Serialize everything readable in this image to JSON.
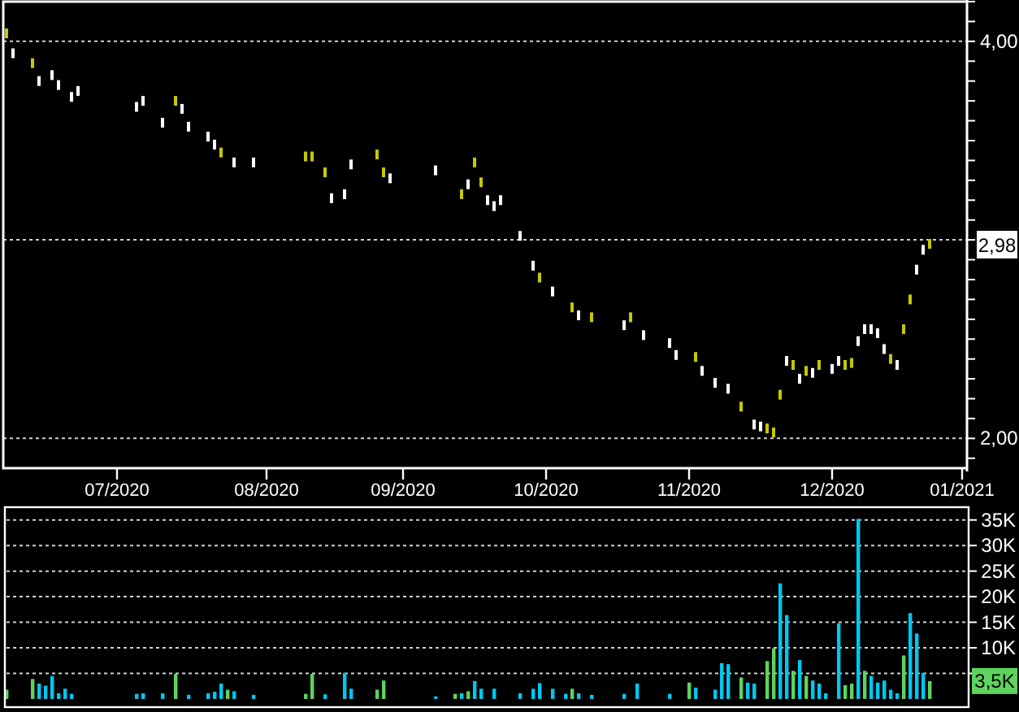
{
  "price_chart": {
    "current_price": "2,98",
    "chart_data": {
      "type": "scatter",
      "grid": true,
      "ylim": [
        1.85,
        4.2
      ],
      "categories": [
        null,
        null,
        null,
        null,
        null,
        null,
        null,
        null,
        null,
        null,
        null,
        null,
        null,
        null,
        null,
        null,
        null,
        "07/2020",
        null,
        null,
        null,
        null,
        null,
        null,
        null,
        null,
        null,
        null,
        null,
        null,
        null,
        null,
        null,
        null,
        null,
        null,
        null,
        null,
        null,
        null,
        "08/2020",
        null,
        null,
        null,
        null,
        null,
        null,
        null,
        null,
        null,
        null,
        null,
        null,
        null,
        null,
        null,
        null,
        null,
        null,
        null,
        null,
        "09/2020",
        null,
        null,
        null,
        null,
        null,
        null,
        null,
        null,
        null,
        null,
        null,
        null,
        null,
        null,
        null,
        null,
        null,
        null,
        null,
        null,
        null,
        "10/2020",
        null,
        null,
        null,
        null,
        null,
        null,
        null,
        null,
        null,
        null,
        null,
        null,
        null,
        null,
        null,
        null,
        null,
        null,
        null,
        null,
        null,
        "11/2020",
        null,
        null,
        null,
        null,
        null,
        null,
        null,
        null,
        null,
        null,
        null,
        null,
        null,
        null,
        null,
        null,
        null,
        null,
        null,
        null,
        null,
        "12/2020",
        null,
        null,
        null,
        null,
        null,
        null,
        null,
        null,
        null,
        null,
        null,
        null,
        null,
        null,
        null,
        null,
        null,
        null,
        null,
        "01/2021"
      ],
      "yticks": [
        {
          "value": 4,
          "label": "4,00"
        },
        {
          "value": 2,
          "label": "2,00"
        }
      ],
      "series": [
        {
          "color": "#c8c800",
          "values": [
            4.04,
            null,
            null,
            null,
            3.89,
            null,
            null,
            null,
            null,
            null,
            null,
            null,
            null,
            null,
            null,
            null,
            null,
            null,
            null,
            null,
            null,
            null,
            null,
            null,
            null,
            null,
            3.7,
            null,
            null,
            null,
            null,
            null,
            null,
            3.44,
            null,
            null,
            null,
            null,
            null,
            null,
            null,
            null,
            null,
            null,
            null,
            null,
            3.42,
            3.42,
            null,
            3.34,
            null,
            null,
            null,
            null,
            null,
            null,
            null,
            3.43,
            3.34,
            null,
            null,
            null,
            null,
            null,
            null,
            null,
            null,
            null,
            null,
            null,
            3.23,
            null,
            3.39,
            3.29,
            null,
            null,
            null,
            null,
            null,
            null,
            null,
            null,
            2.81,
            null,
            null,
            null,
            null,
            2.66,
            null,
            null,
            2.61,
            null,
            null,
            null,
            null,
            null,
            2.61,
            null,
            null,
            null,
            null,
            null,
            null,
            null,
            null,
            null,
            2.41,
            null,
            null,
            null,
            null,
            null,
            null,
            2.16,
            null,
            null,
            null,
            2.05,
            2.03,
            2.22,
            null,
            2.37,
            null,
            2.34,
            null,
            2.37,
            null,
            null,
            null,
            2.37,
            2.38,
            null,
            null,
            null,
            null,
            null,
            2.4,
            null,
            2.55,
            2.7,
            null,
            null,
            2.98,
            null,
            null,
            null,
            null,
            null
          ]
        },
        {
          "color": "#ffffff",
          "values": [
            null,
            3.94,
            null,
            null,
            null,
            3.8,
            null,
            3.83,
            3.78,
            null,
            3.72,
            3.75,
            null,
            null,
            null,
            null,
            null,
            null,
            null,
            null,
            3.67,
            3.7,
            null,
            null,
            3.59,
            null,
            null,
            3.66,
            3.57,
            null,
            null,
            3.52,
            3.48,
            null,
            null,
            3.39,
            null,
            null,
            3.39,
            null,
            null,
            null,
            null,
            null,
            null,
            null,
            null,
            null,
            null,
            null,
            3.21,
            null,
            3.23,
            3.38,
            null,
            null,
            null,
            null,
            null,
            3.31,
            null,
            null,
            null,
            null,
            null,
            null,
            3.35,
            null,
            null,
            null,
            null,
            3.28,
            null,
            null,
            3.2,
            3.17,
            3.2,
            null,
            null,
            3.02,
            null,
            2.87,
            null,
            null,
            2.74,
            null,
            null,
            null,
            2.62,
            null,
            null,
            null,
            null,
            null,
            null,
            2.57,
            null,
            null,
            2.52,
            null,
            null,
            null,
            2.48,
            2.42,
            null,
            null,
            null,
            2.34,
            null,
            2.28,
            null,
            2.25,
            null,
            null,
            null,
            2.07,
            2.06,
            null,
            null,
            null,
            2.39,
            null,
            2.3,
            null,
            2.33,
            null,
            null,
            2.35,
            2.39,
            null,
            null,
            2.49,
            2.55,
            2.55,
            2.53,
            2.45,
            null,
            2.37,
            null,
            null,
            2.85,
            2.95,
            null,
            null,
            null,
            null,
            null,
            null
          ]
        }
      ]
    }
  },
  "volume_chart": {
    "current_volume": "3,5K",
    "chart_data": {
      "type": "bar",
      "grid": true,
      "ylim": [
        -1600,
        37500
      ],
      "categories": [
        null,
        null,
        null,
        null,
        null,
        null,
        null,
        null,
        null,
        null,
        null,
        null,
        null,
        null,
        null,
        null,
        null,
        null,
        null,
        null,
        null,
        null,
        null,
        null,
        null,
        null,
        null,
        null,
        null,
        null,
        null,
        null,
        null,
        null,
        null,
        null,
        null,
        null,
        null,
        null,
        null,
        null,
        null,
        null,
        null,
        null,
        null,
        null,
        null,
        null,
        null,
        null,
        null,
        null,
        null,
        null,
        null,
        null,
        null,
        null,
        null,
        null,
        null,
        null,
        null,
        null,
        null,
        null,
        null,
        null,
        null,
        null,
        null,
        null,
        null,
        null,
        null,
        null,
        null,
        null,
        null,
        null,
        null,
        null,
        null,
        null,
        null,
        null,
        null,
        null,
        null,
        null,
        null,
        null,
        null,
        null,
        null,
        null,
        null,
        null,
        null,
        null,
        null,
        null,
        null,
        null,
        null,
        null,
        null,
        null,
        null,
        null,
        null,
        null,
        null,
        null,
        null,
        null,
        null,
        null,
        null,
        null,
        null,
        null,
        null,
        null,
        null,
        null,
        null,
        null,
        null,
        null,
        null,
        null,
        null,
        null,
        null,
        null,
        null,
        null,
        null,
        null,
        null,
        null,
        null,
        null,
        null,
        null
      ],
      "yticks": [
        {
          "value": 10000,
          "label": "10K"
        },
        {
          "value": 15000,
          "label": "15K"
        },
        {
          "value": 20000,
          "label": "20K"
        },
        {
          "value": 25000,
          "label": "25K"
        },
        {
          "value": 30000,
          "label": "30K"
        },
        {
          "value": 35000,
          "label": "35K"
        }
      ],
      "series": [
        {
          "color": "#5ed35e",
          "values": [
            1800,
            null,
            null,
            null,
            3900,
            null,
            null,
            null,
            null,
            null,
            null,
            null,
            null,
            null,
            null,
            null,
            null,
            null,
            null,
            null,
            null,
            null,
            null,
            null,
            null,
            null,
            4900,
            null,
            null,
            null,
            null,
            null,
            null,
            null,
            1800,
            null,
            null,
            null,
            null,
            null,
            null,
            null,
            null,
            null,
            null,
            null,
            1000,
            4900,
            null,
            null,
            null,
            null,
            null,
            null,
            null,
            null,
            null,
            1800,
            3600,
            null,
            null,
            null,
            null,
            null,
            null,
            null,
            null,
            null,
            null,
            1000,
            null,
            1500,
            null,
            null,
            null,
            null,
            null,
            null,
            null,
            null,
            null,
            null,
            null,
            null,
            null,
            null,
            null,
            2000,
            null,
            null,
            null,
            null,
            null,
            null,
            null,
            null,
            null,
            null,
            null,
            null,
            null,
            null,
            null,
            null,
            null,
            3200,
            null,
            null,
            null,
            null,
            null,
            null,
            null,
            4200,
            null,
            null,
            null,
            7400,
            9900,
            null,
            null,
            5500,
            null,
            4500,
            null,
            null,
            null,
            null,
            null,
            2700,
            3000,
            null,
            5500,
            null,
            null,
            null,
            null,
            null,
            8500,
            null,
            null,
            null,
            3500,
            null,
            null,
            null,
            null,
            null
          ]
        },
        {
          "color": "#00c8f0",
          "values": [
            null,
            null,
            null,
            null,
            null,
            3000,
            2600,
            4500,
            1100,
            2000,
            1000,
            null,
            null,
            null,
            null,
            null,
            null,
            null,
            null,
            null,
            1000,
            1100,
            null,
            null,
            1100,
            null,
            null,
            null,
            800,
            null,
            null,
            1100,
            1400,
            3000,
            null,
            1500,
            null,
            null,
            800,
            null,
            null,
            null,
            null,
            null,
            null,
            null,
            null,
            null,
            null,
            900,
            null,
            null,
            5100,
            2000,
            null,
            null,
            null,
            null,
            null,
            null,
            null,
            null,
            null,
            null,
            null,
            null,
            500,
            null,
            null,
            null,
            1100,
            null,
            3500,
            2000,
            null,
            2000,
            null,
            null,
            null,
            1100,
            null,
            2000,
            3100,
            null,
            2000,
            null,
            1000,
            null,
            1100,
            null,
            800,
            null,
            null,
            null,
            null,
            1000,
            null,
            3000,
            null,
            null,
            null,
            null,
            1000,
            null,
            null,
            null,
            2200,
            null,
            null,
            1800,
            7000,
            6800,
            null,
            null,
            3200,
            3000,
            null,
            null,
            null,
            22600,
            16400,
            null,
            7600,
            null,
            3600,
            3000,
            1100,
            null,
            14800,
            null,
            null,
            35200,
            null,
            4500,
            3200,
            3600,
            1800,
            1100,
            null,
            16800,
            12800,
            5100,
            null,
            null,
            null,
            null,
            null,
            null
          ]
        }
      ]
    }
  }
}
